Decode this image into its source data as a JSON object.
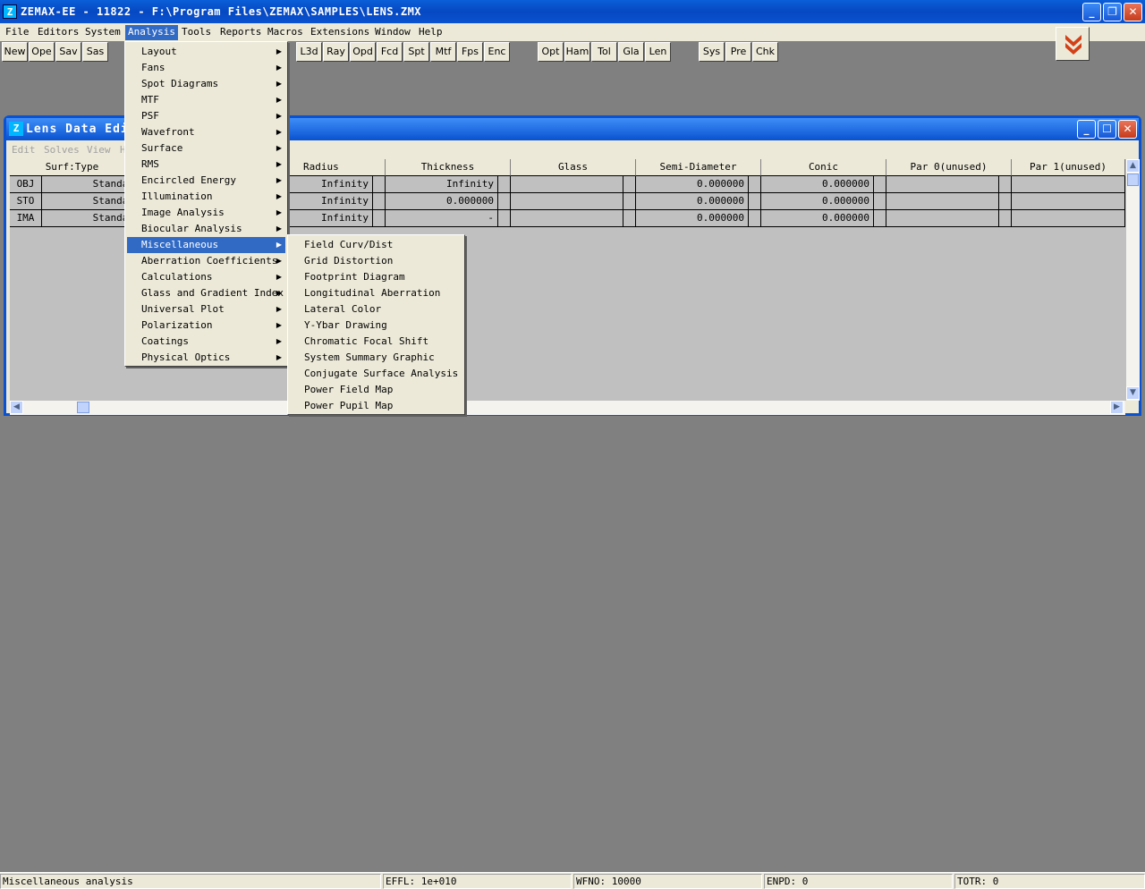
{
  "app": {
    "title": "ZEMAX-EE - 11822 - F:\\Program Files\\ZEMAX\\SAMPLES\\LENS.ZMX",
    "icon_label": "Z"
  },
  "menubar": {
    "items": [
      "File",
      "Editors",
      "System",
      "Analysis",
      "Tools",
      "Reports",
      "Macros",
      "Extensions",
      "Window",
      "Help"
    ],
    "active": "Analysis"
  },
  "toolbar": {
    "buttons": [
      "New",
      "Ope",
      "Sav",
      "Sas",
      "L3d",
      "Ray",
      "Opd",
      "Fcd",
      "Spt",
      "Mtf",
      "Fps",
      "Enc",
      "Opt",
      "Ham",
      "Tol",
      "Gla",
      "Len",
      "Sys",
      "Pre",
      "Chk"
    ]
  },
  "editor": {
    "title": "Lens Data Edit",
    "menus": [
      "Edit",
      "Solves",
      "View",
      "H"
    ],
    "columns": [
      "Surf:Type",
      "Radius",
      "Thickness",
      "Glass",
      "Semi-Diameter",
      "Conic",
      "Par 0(unused)",
      "Par 1(unused)"
    ],
    "rows": [
      {
        "surf": "OBJ",
        "type": "Standar",
        "radius": "Infinity",
        "thickness": "Infinity",
        "glass": "",
        "semi": "0.000000",
        "conic": "0.000000"
      },
      {
        "surf": "STO",
        "type": "Standar",
        "radius": "Infinity",
        "thickness": "0.000000",
        "glass": "",
        "semi": "0.000000",
        "conic": "0.000000"
      },
      {
        "surf": "IMA",
        "type": "Standar",
        "radius": "Infinity",
        "thickness": "-",
        "glass": "",
        "semi": "0.000000",
        "conic": "0.000000"
      }
    ]
  },
  "analysis_menu": {
    "items": [
      "Layout",
      "Fans",
      "Spot Diagrams",
      "MTF",
      "PSF",
      "Wavefront",
      "Surface",
      "RMS",
      "Encircled Energy",
      "Illumination",
      "Image Analysis",
      "Biocular Analysis",
      "Miscellaneous",
      "Aberration Coefficients",
      "Calculations",
      "Glass and Gradient Index",
      "Universal Plot",
      "Polarization",
      "Coatings",
      "Physical Optics"
    ],
    "highlighted": "Miscellaneous"
  },
  "misc_submenu": {
    "items": [
      "Field Curv/Dist",
      "Grid Distortion",
      "Footprint Diagram",
      "Longitudinal Aberration",
      "Lateral Color",
      "Y-Ybar Drawing",
      "Chromatic Focal Shift",
      "System Summary Graphic",
      "Conjugate Surface Analysis",
      "Power Field Map",
      "Power Pupil Map"
    ]
  },
  "statusbar": {
    "message": "Miscellaneous analysis",
    "effl": "EFFL: 1e+010",
    "wfno": "WFNO: 10000",
    "enpd": "ENPD: 0",
    "totr": "TOTR: 0"
  },
  "icons": {
    "corner": "double-chevron-down-icon",
    "submenu_arrow": "triangle-right-icon"
  },
  "colors": {
    "titlebar": "#0648c2",
    "desktop": "#808080",
    "highlight": "#316ac5",
    "chrome": "#ece9d8"
  }
}
